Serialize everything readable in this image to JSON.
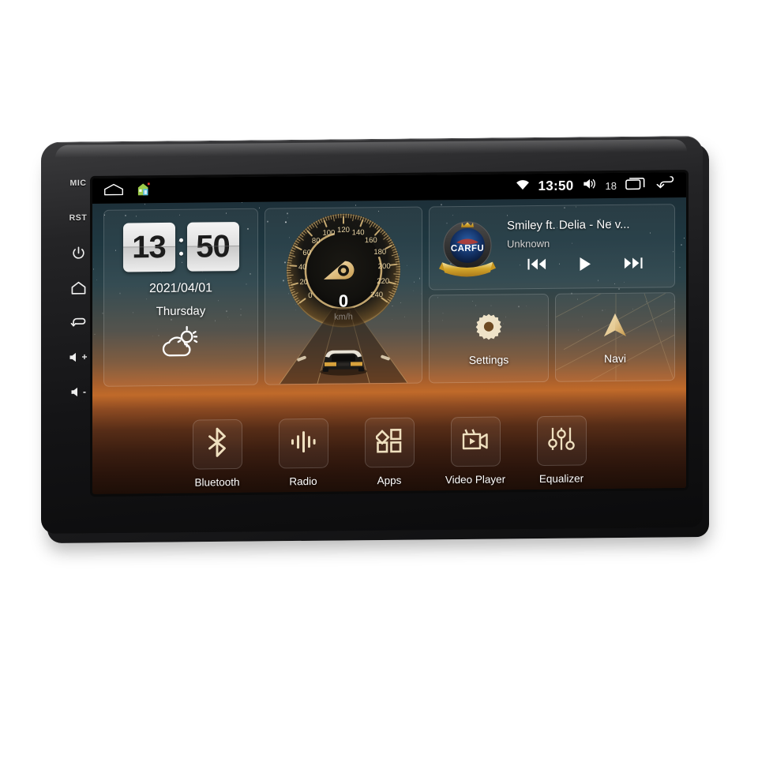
{
  "device": {
    "type": "android-car-head-unit",
    "bezel_keys": [
      {
        "name": "mic",
        "label": "MIC",
        "kind": "text"
      },
      {
        "name": "reset",
        "label": "RST",
        "kind": "text"
      },
      {
        "name": "power",
        "label": "",
        "kind": "power-icon"
      },
      {
        "name": "home",
        "label": "",
        "kind": "home-icon"
      },
      {
        "name": "back",
        "label": "",
        "kind": "back-icon"
      },
      {
        "name": "volume-up",
        "label": "+",
        "kind": "volume-icon"
      },
      {
        "name": "volume-down",
        "label": "-",
        "kind": "volume-icon"
      }
    ]
  },
  "statusbar": {
    "home_outline_icon": "home-outline-icon",
    "house_icon": "house-color-icon",
    "wifi_icon": "wifi-icon",
    "time": "13:50",
    "volume_icon": "volume-icon",
    "volume_level": "18",
    "recents_icon": "recents-icon",
    "back_icon": "back-arrow-icon"
  },
  "clock_widget": {
    "hours": "13",
    "minutes": "50",
    "date": "2021/04/01",
    "weekday": "Thursday",
    "weather_icon": "sun-behind-cloud-icon"
  },
  "speedometer": {
    "value": "0",
    "unit": "km/h",
    "ticks": [
      "0",
      "20",
      "40",
      "60",
      "80",
      "100",
      "120",
      "140",
      "160",
      "180",
      "200",
      "220",
      "240"
    ],
    "min": 0,
    "max": 240,
    "needle_icon": "needle-pointer-icon",
    "car_icon": "car-rear-icon"
  },
  "media_widget": {
    "logo_text": "CARFU",
    "logo_icon": "carfu-badge-icon",
    "title": "Smiley ft. Delia - Ne v...",
    "artist": "Unknown",
    "prev_icon": "skip-previous-icon",
    "play_icon": "play-icon",
    "next_icon": "skip-next-icon"
  },
  "tiles": [
    {
      "name": "settings",
      "label": "Settings",
      "icon": "gear-icon"
    },
    {
      "name": "navi",
      "label": "Navi",
      "icon": "navigation-arrow-icon"
    }
  ],
  "dock": [
    {
      "name": "bluetooth",
      "label": "Bluetooth",
      "icon": "bluetooth-icon"
    },
    {
      "name": "radio",
      "label": "Radio",
      "icon": "radio-waves-icon"
    },
    {
      "name": "apps",
      "label": "Apps",
      "icon": "apps-grid-icon"
    },
    {
      "name": "video-player",
      "label": "Video Player",
      "icon": "video-camera-icon"
    },
    {
      "name": "equalizer",
      "label": "Equalizer",
      "icon": "equalizer-sliders-icon"
    }
  ],
  "colors": {
    "accent_gold": "#e8d2a0",
    "sky_top": "#1d3039",
    "horizon": "#c06a2a",
    "ground": "#2a140b",
    "statusbar_bg": "#000000",
    "bezel": "#1a1a1c"
  }
}
